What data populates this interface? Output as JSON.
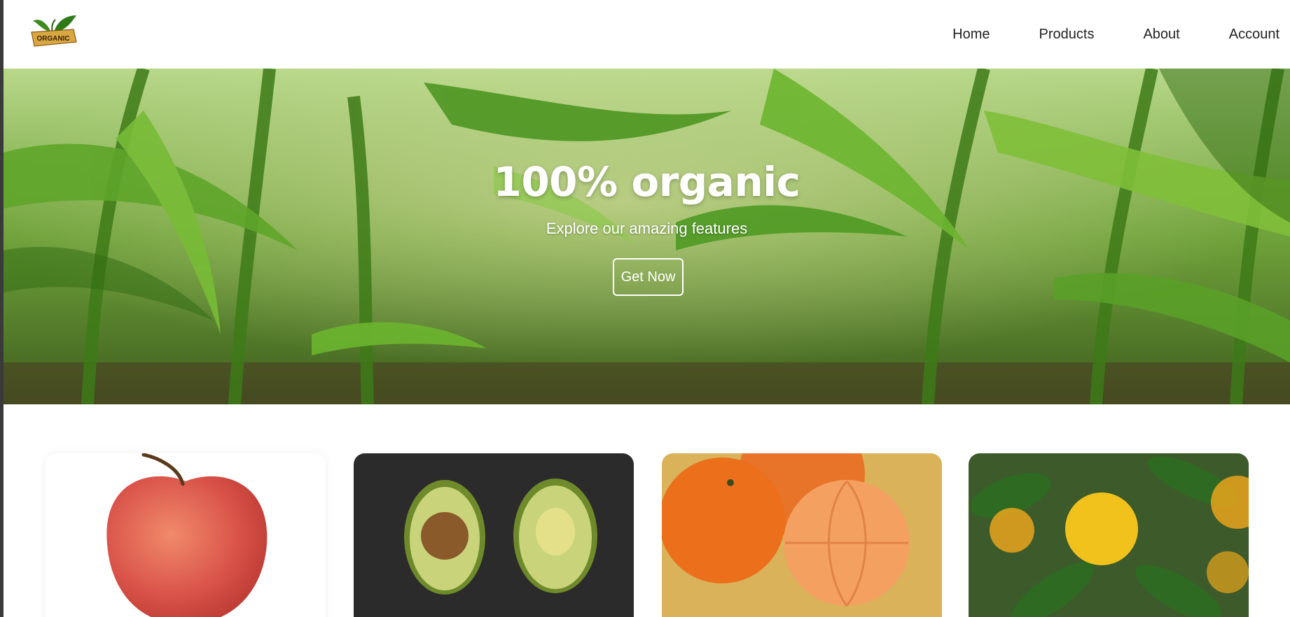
{
  "brand": {
    "logo_text": "ORGANIC"
  },
  "nav": {
    "items": [
      {
        "label": "Home"
      },
      {
        "label": "Products"
      },
      {
        "label": "About"
      },
      {
        "label": "Account"
      }
    ]
  },
  "hero": {
    "title": "100% organic",
    "subtitle": "Explore our amazing features",
    "button_label": "Get Now"
  },
  "products": {
    "cards": [
      {
        "name": "apple-image"
      },
      {
        "name": "avocado-image"
      },
      {
        "name": "mandarin-image"
      },
      {
        "name": "lemon-tree-image"
      }
    ]
  },
  "colors": {
    "accent_green": "#4a8f1e",
    "text_dark": "#222222",
    "hero_text": "#ffffff"
  }
}
